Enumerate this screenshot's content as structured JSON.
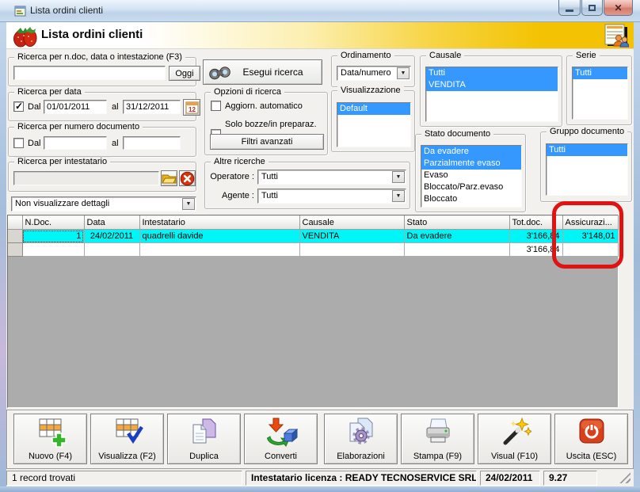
{
  "window": {
    "title": "Lista ordini clienti"
  },
  "header": {
    "title": "Lista ordini clienti"
  },
  "search_doc": {
    "legend": "Ricerca per n.doc, data o intestazione (F3)",
    "value": "",
    "oggi": "Oggi"
  },
  "search_date": {
    "legend": "Ricerca per data",
    "dal": "Dal",
    "dal_value": "01/01/2011",
    "al": "al",
    "al_value": "31/12/2011"
  },
  "search_number": {
    "legend": "Ricerca per numero documento",
    "dal": "Dal",
    "dal_value": "",
    "al": "al",
    "al_value": ""
  },
  "search_holder": {
    "legend": "Ricerca per intestatario",
    "value": ""
  },
  "details_combo": {
    "value": "Non visualizzare dettagli"
  },
  "search_button": {
    "label": "Esegui ricerca"
  },
  "options": {
    "legend": "Opzioni di ricerca",
    "auto_update": "Aggiorn. automatico",
    "drafts_only": "Solo bozze/in preparaz.",
    "advanced": "Filtri avanzati"
  },
  "other_search": {
    "legend": "Altre ricerche",
    "operator_label": "Operatore :",
    "operator_value": "Tutti",
    "agent_label": "Agente :",
    "agent_value": "Tutti"
  },
  "sorting": {
    "legend": "Ordinamento",
    "value": "Data/numero"
  },
  "view": {
    "legend": "Visualizzazione",
    "items": [
      {
        "label": "Default",
        "selected": true
      }
    ]
  },
  "reason": {
    "legend": "Causale",
    "items": [
      {
        "label": "Tutti",
        "selected": true
      },
      {
        "label": "VENDITA",
        "selected": true
      }
    ]
  },
  "series": {
    "legend": "Serie",
    "items": [
      {
        "label": "Tutti",
        "selected": true
      }
    ]
  },
  "doc_status": {
    "legend": "Stato documento",
    "items": [
      {
        "label": "Da evadere",
        "selected": true
      },
      {
        "label": "Parzialmente evaso",
        "selected": true
      },
      {
        "label": "Evaso",
        "selected": false
      },
      {
        "label": "Bloccato/Parz.evaso",
        "selected": false
      },
      {
        "label": "Bloccato",
        "selected": false
      }
    ]
  },
  "doc_group": {
    "legend": "Gruppo documento",
    "items": [
      {
        "label": "Tutti",
        "selected": true
      }
    ]
  },
  "grid": {
    "columns": [
      "N.Doc.",
      "Data",
      "Intestatario",
      "Causale",
      "Stato",
      "Tot.doc.",
      "Assicurazi..."
    ],
    "rows": [
      {
        "ndoc": "1",
        "date": "24/02/2011",
        "holder": "quadrelli davide",
        "reason": "VENDITA",
        "status": "Da evadere",
        "total": "3'166,84",
        "insurance": "3'148,01"
      }
    ],
    "totals": {
      "total": "3'166,84"
    }
  },
  "toolbar": {
    "buttons": [
      {
        "label": "Nuovo (F4)"
      },
      {
        "label": "Visualizza (F2)"
      },
      {
        "label": "Duplica"
      },
      {
        "label": "Converti"
      },
      {
        "label": "Elaborazioni"
      },
      {
        "label": "Stampa (F9)"
      },
      {
        "label": "Visual (F10)"
      },
      {
        "label": "Uscita (ESC)"
      }
    ]
  },
  "statusbar": {
    "records": "1 record trovati",
    "license": "Intestatario licenza : READY TECNOSERVICE SRL",
    "date": "24/02/2011",
    "time": "9.27"
  },
  "colors": {
    "selection": "#3598FE",
    "row_highlight": "#00F6F6",
    "annotation": "#E01212",
    "header_gold": "#F3C303"
  }
}
